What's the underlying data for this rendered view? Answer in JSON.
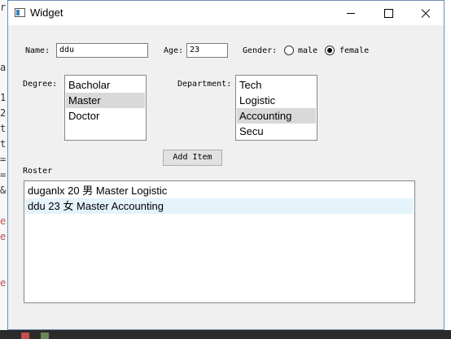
{
  "window": {
    "title": "Widget",
    "icon": "app-window-icon"
  },
  "form": {
    "name_label": "Name:",
    "name_value": "ddu",
    "age_label": "Age:",
    "age_value": "23",
    "gender_label": "Gender:",
    "gender_options": [
      "male",
      "female"
    ],
    "gender_selected": "female",
    "degree_label": "Degree:",
    "degree_items": [
      "Bacholar",
      "Master",
      "Doctor"
    ],
    "degree_selected": "Master",
    "department_label": "Department:",
    "department_items": [
      "Tech",
      "Logistic",
      "Accounting",
      "Secu"
    ],
    "department_selected": "Accounting",
    "add_button_label": "Add Item"
  },
  "roster": {
    "label": "Roster",
    "rows": [
      "duganlx 20 男 Master Logistic",
      "ddu 23 女 Master Accounting"
    ],
    "selected_row": 1
  },
  "background_editor": {
    "left_glyphs": [
      "r",
      "a",
      "1",
      "2",
      "t",
      "t",
      "=",
      "=",
      "&",
      "e",
      "e",
      "e"
    ]
  }
}
